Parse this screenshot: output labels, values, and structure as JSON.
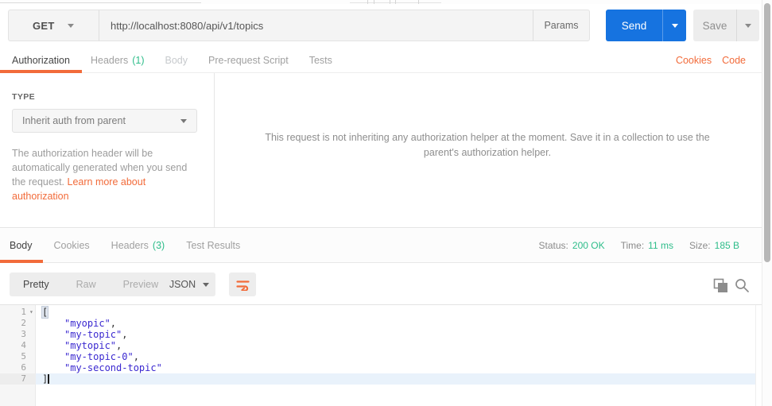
{
  "colors": {
    "accent_orange": "#f26b3a",
    "send_blue": "#1673e0",
    "success_green": "#2ebd8a",
    "json_string": "#3a28d0"
  },
  "request_bar": {
    "method": "GET",
    "url": "http://localhost:8080/api/v1/topics",
    "params_label": "Params",
    "send_label": "Send",
    "save_label": "Save"
  },
  "request_tabs": {
    "authorization": "Authorization",
    "headers": "Headers",
    "headers_count": "(1)",
    "body": "Body",
    "prerequest": "Pre-request Script",
    "tests": "Tests",
    "cookies_link": "Cookies",
    "code_link": "Code"
  },
  "auth_panel": {
    "type_label": "TYPE",
    "type_value": "Inherit auth from parent",
    "help_text": "The authorization header will be automatically generated when you send the request. ",
    "help_link": "Learn more about authorization",
    "parent_message": "This request is not inheriting any authorization helper at the moment. Save it in a collection to use the parent's authorization helper."
  },
  "response": {
    "tab_body": "Body",
    "tab_cookies": "Cookies",
    "tab_headers": "Headers",
    "tab_headers_count": "(3)",
    "tab_tests": "Test Results",
    "status_label": "Status:",
    "status_value": "200 OK",
    "time_label": "Time:",
    "time_value": "11 ms",
    "size_label": "Size:",
    "size_value": "185 B",
    "mode_pretty": "Pretty",
    "mode_raw": "Raw",
    "mode_preview": "Preview",
    "language": "JSON"
  },
  "editor": {
    "lines": [
      {
        "num": "1",
        "text": "[",
        "fold": "▾"
      },
      {
        "num": "2",
        "string": "\"myopic\"",
        "suffix": ","
      },
      {
        "num": "3",
        "string": "\"my-topic\"",
        "suffix": ","
      },
      {
        "num": "4",
        "string": "\"mytopic\"",
        "suffix": ","
      },
      {
        "num": "5",
        "string": "\"my-topic-0\"",
        "suffix": ","
      },
      {
        "num": "6",
        "string": "\"my-second-topic\"",
        "suffix": ""
      },
      {
        "num": "7",
        "text": "]"
      }
    ]
  }
}
